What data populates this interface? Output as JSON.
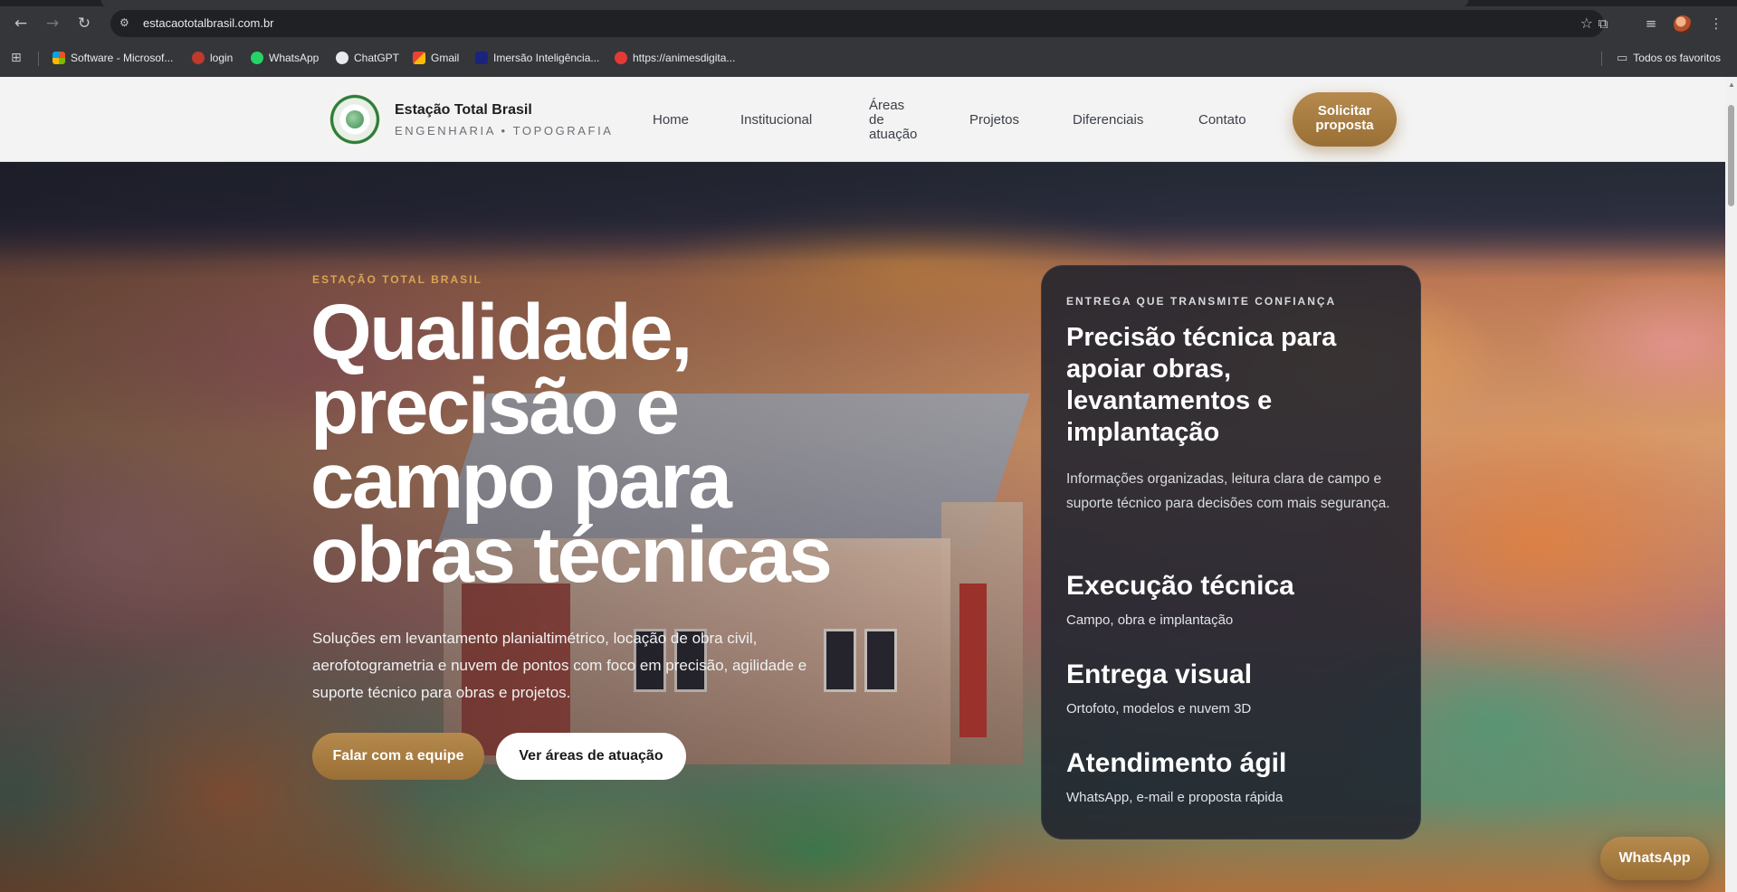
{
  "browser": {
    "url": "estacaototalbrasil.com.br",
    "bookmarks": [
      {
        "label": "Software - Microsof...",
        "color": "#f25022"
      },
      {
        "label": "login",
        "color": "#c0392b"
      },
      {
        "label": "WhatsApp",
        "color": "#25d366"
      },
      {
        "label": "ChatGPT",
        "color": "#e8eaed"
      },
      {
        "label": "Gmail",
        "color": "#ea4335"
      },
      {
        "label": "Imersão Inteligência...",
        "color": "#1a237e"
      },
      {
        "label": "https://animesdigita...",
        "color": "#e53935"
      }
    ],
    "all_favorites": "Todos os favoritos"
  },
  "header": {
    "brand_name": "Estação Total Brasil",
    "brand_tagline": "ENGENHARIA • TOPOGRAFIA",
    "nav": {
      "home": "Home",
      "institucional": "Institucional",
      "areas_line1": "Áreas",
      "areas_line2": "de",
      "areas_line3": "atuação",
      "projetos": "Projetos",
      "diferenciais": "Diferenciais",
      "contato": "Contato"
    },
    "cta_line1": "Solicitar",
    "cta_line2": "proposta"
  },
  "hero": {
    "eyebrow": "ESTAÇÃO TOTAL BRASIL",
    "title": "Qualidade, precisão e campo para obras técnicas",
    "subtitle": "Soluções em levantamento planialtimétrico, locação de obra civil, aerofotogrametria e nuvem de pontos com foco em precisão, agilidade e suporte técnico para obras e projetos.",
    "primary_button": "Falar com a equipe",
    "secondary_button": "Ver áreas de atuação"
  },
  "card": {
    "eyebrow": "ENTREGA QUE TRANSMITE CONFIANÇA",
    "title": "Precisão técnica para apoiar obras, levantamentos e implantação",
    "text": "Informações organizadas, leitura clara de campo e suporte técnico para decisões com mais segurança.",
    "features": [
      {
        "title": "Execução técnica",
        "subtitle": "Campo, obra e implantação"
      },
      {
        "title": "Entrega visual",
        "subtitle": "Ortofoto, modelos e nuvem 3D"
      },
      {
        "title": "Atendimento ágil",
        "subtitle": "WhatsApp, e-mail e proposta rápida"
      }
    ]
  },
  "floating": {
    "whatsapp": "WhatsApp"
  },
  "colors": {
    "accent_gold": "#b68a4d",
    "eyebrow_gold": "#d8a455",
    "card_bg": "#1c212c"
  }
}
